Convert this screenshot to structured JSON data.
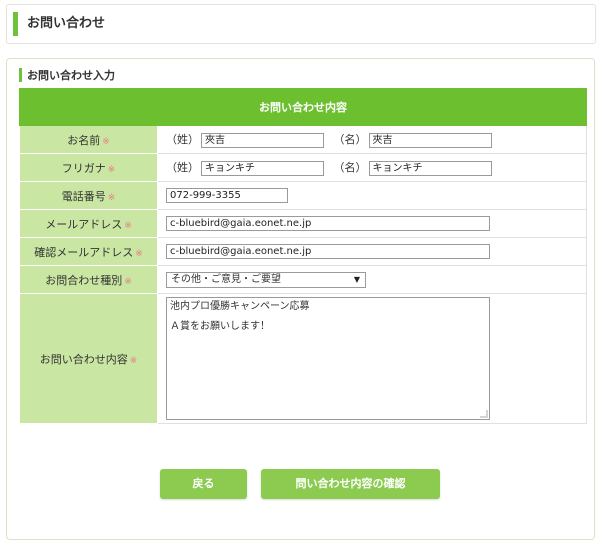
{
  "header": {
    "title": "お問い合わせ"
  },
  "section": {
    "title": "お問い合わせ入力"
  },
  "form": {
    "table_title": "お問い合わせ内容",
    "required_mark": "※",
    "name": {
      "label": "お名前",
      "sei_label": "（姓）",
      "sei_value": "夾吉",
      "mei_label": "（名）",
      "mei_value": "夾吉"
    },
    "furigana": {
      "label": "フリガナ",
      "sei_label": "（姓）",
      "sei_value": "キョンキチ",
      "mei_label": "（名）",
      "mei_value": "キョンキチ"
    },
    "phone": {
      "label": "電話番号",
      "value": "072-999-3355"
    },
    "email": {
      "label": "メールアドレス",
      "value": "c-bluebird@gaia.eonet.ne.jp"
    },
    "email_confirm": {
      "label": "確認メールアドレス",
      "value": "c-bluebird@gaia.eonet.ne.jp"
    },
    "inquiry_type": {
      "label": "お問合わせ種別",
      "selected": "その他・ご意見・ご要望"
    },
    "message": {
      "label": "お問い合わせ内容",
      "line1": "池内プロ優勝キャンペーン応募",
      "line2": "Ａ賞をお願いします！"
    }
  },
  "buttons": {
    "back": "戻る",
    "confirm": "問い合わせ内容の確認"
  },
  "colors": {
    "accent": "#6cc030",
    "label_bg": "#c9e6a3",
    "button": "#8ccb50",
    "required": "#e77c88"
  }
}
